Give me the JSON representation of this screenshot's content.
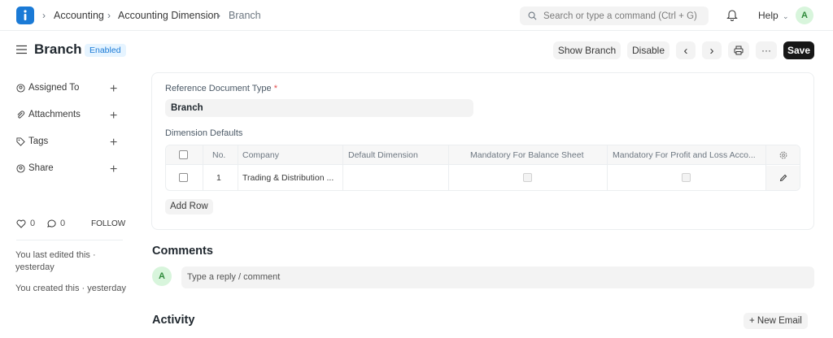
{
  "navbar": {
    "breadcrumbs": [
      "Accounting",
      "Accounting Dimension",
      "Branch"
    ],
    "search_placeholder": "Search or type a command (Ctrl + G)",
    "help_label": "Help",
    "avatar_initial": "A"
  },
  "page": {
    "title": "Branch",
    "status_badge": "Enabled",
    "actions": {
      "show_branch": "Show Branch",
      "disable": "Disable",
      "prev": "‹",
      "next": "›",
      "more": "···",
      "save": "Save"
    }
  },
  "sidebar": {
    "items": [
      {
        "label": "Assigned To",
        "icon": "assign-icon"
      },
      {
        "label": "Attachments",
        "icon": "paperclip-icon"
      },
      {
        "label": "Tags",
        "icon": "tag-icon"
      },
      {
        "label": "Share",
        "icon": "share-icon"
      }
    ],
    "likes": "0",
    "comments": "0",
    "follow_label": "FOLLOW",
    "last_edited": "You last edited this · yesterday",
    "created": "You created this · yesterday"
  },
  "form": {
    "reference_label": "Reference Document Type",
    "required_mark": "*",
    "reference_value": "Branch",
    "defaults_label": "Dimension Defaults",
    "table": {
      "columns": [
        "No.",
        "Company",
        "Default Dimension",
        "Mandatory For Balance Sheet",
        "Mandatory For Profit and Loss Acco..."
      ],
      "rows": [
        {
          "no": "1",
          "company": "Trading & Distribution ...",
          "default_dimension": "",
          "mandatory_bs": false,
          "mandatory_pl": false
        }
      ]
    },
    "add_row_label": "Add Row"
  },
  "comments": {
    "heading": "Comments",
    "avatar_initial": "A",
    "placeholder": "Type a reply / comment"
  },
  "activity": {
    "heading": "Activity",
    "new_email_label": "+ New Email"
  },
  "colors": {
    "brand": "#1a7ad6",
    "badge_bg": "#e6f4ff",
    "save_bg": "#171717",
    "avatar_bg": "#d8f5dc"
  }
}
